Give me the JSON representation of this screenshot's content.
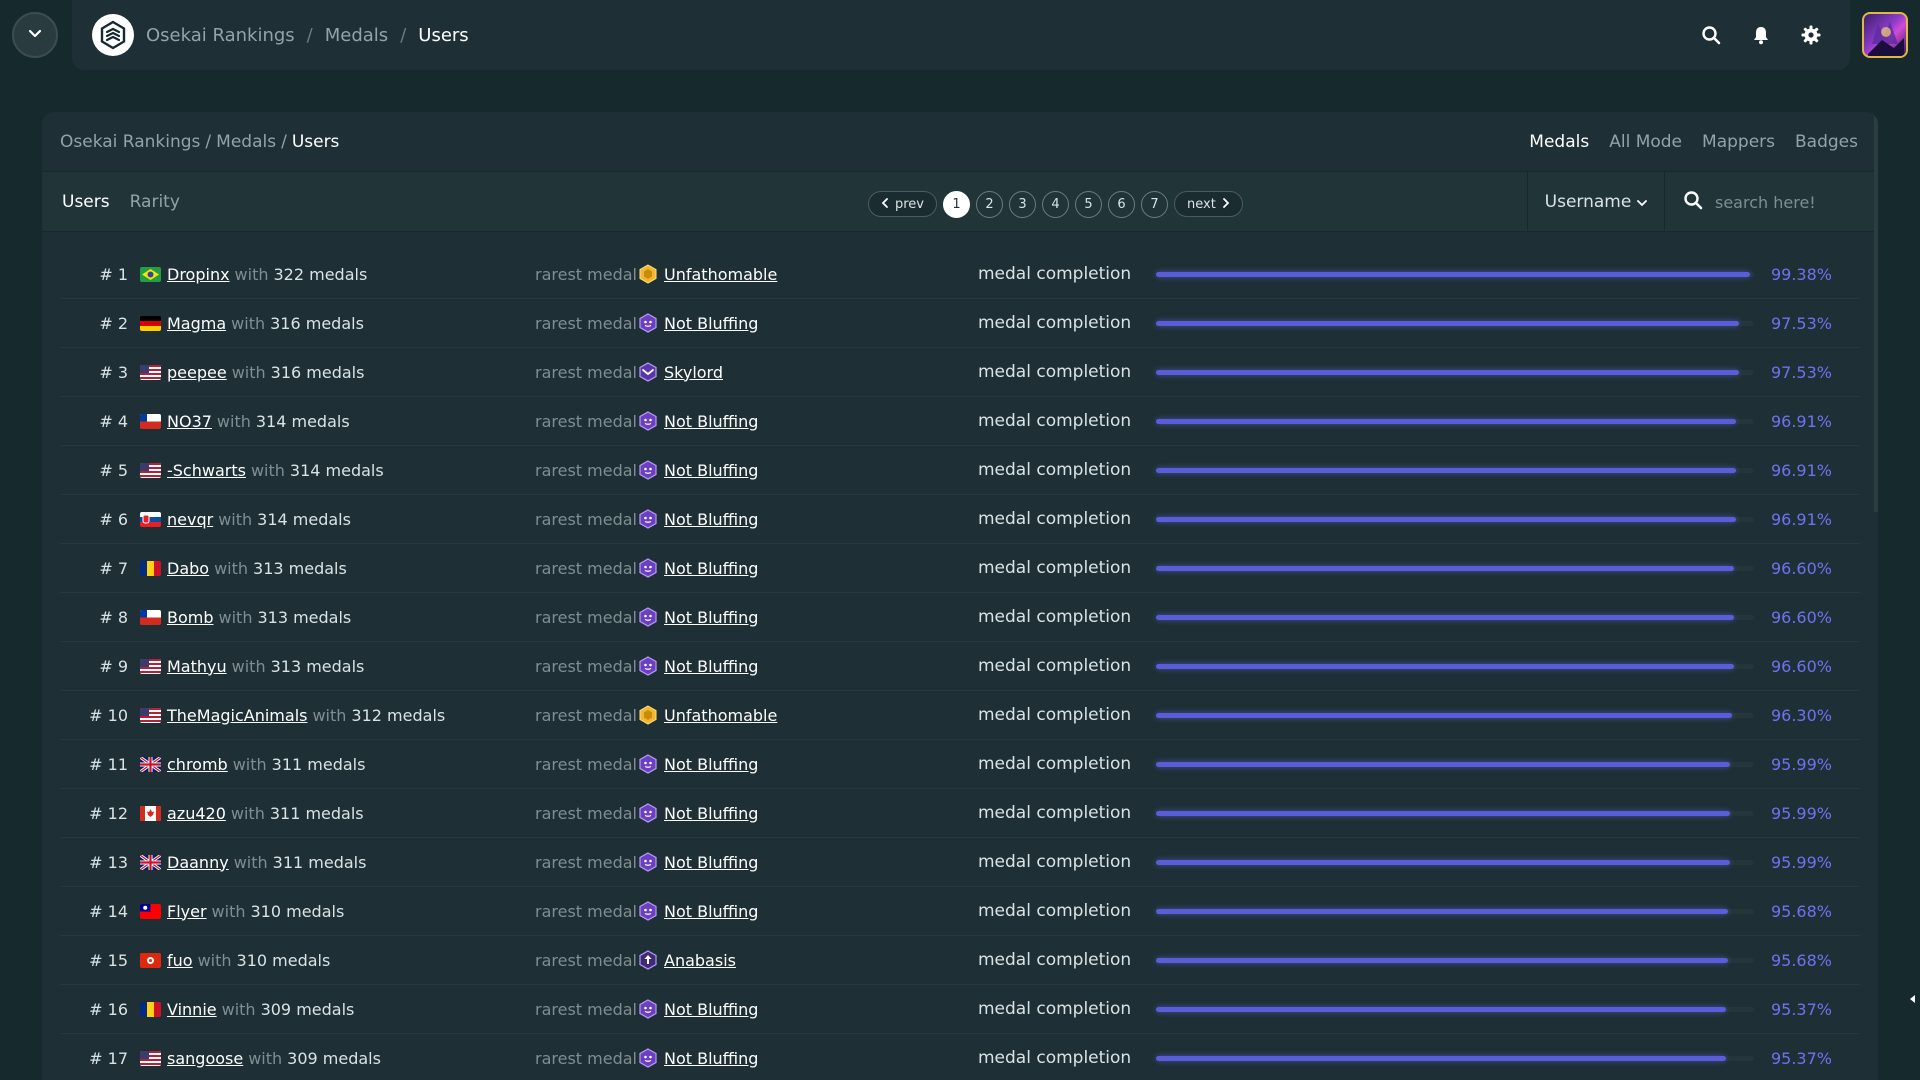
{
  "nav": {
    "breadcrumb": [
      "Osekai Rankings",
      "Medals",
      "Users"
    ]
  },
  "panel": {
    "breadcrumb": [
      "Osekai Rankings",
      "Medals",
      "Users"
    ],
    "mode_tabs": [
      "Medals",
      "All Mode",
      "Mappers",
      "Badges"
    ],
    "active_mode": "Medals"
  },
  "toolbar": {
    "view_tabs": [
      "Users",
      "Rarity"
    ],
    "active_view": "Users",
    "prev_label": "prev",
    "next_label": "next",
    "pages": [
      "1",
      "2",
      "3",
      "4",
      "5",
      "6",
      "7"
    ],
    "current_page": "1",
    "sort_label": "Username",
    "search_placeholder": "search here!"
  },
  "labels": {
    "with": "with",
    "rarest_medal": "rarest medal",
    "medal_completion": "medal completion"
  },
  "colors": {
    "background": "#16292d",
    "panel": "#1e3035",
    "accent": "#6f72f0",
    "bar": "#5a5dd8"
  },
  "rows": [
    {
      "rank": "# 1",
      "flag": "br",
      "username": "Dropinx",
      "medals": "322 medals",
      "rarest": "Unfathomable",
      "medal_icon": "gold-hexagon-medal-icon",
      "completion": "99.38%"
    },
    {
      "rank": "# 2",
      "flag": "de",
      "username": "Magma",
      "medals": "316 medals",
      "rarest": "Not Bluffing",
      "medal_icon": "purple-hexagon-medal-icon",
      "completion": "97.53%"
    },
    {
      "rank": "# 3",
      "flag": "us",
      "username": "peepee",
      "medals": "316 medals",
      "rarest": "Skylord",
      "medal_icon": "purple-shield-medal-icon",
      "completion": "97.53%"
    },
    {
      "rank": "# 4",
      "flag": "cl",
      "username": "NO37",
      "medals": "314 medals",
      "rarest": "Not Bluffing",
      "medal_icon": "purple-hexagon-medal-icon",
      "completion": "96.91%"
    },
    {
      "rank": "# 5",
      "flag": "us",
      "username": "-Schwarts",
      "medals": "314 medals",
      "rarest": "Not Bluffing",
      "medal_icon": "purple-hexagon-medal-icon",
      "completion": "96.91%"
    },
    {
      "rank": "# 6",
      "flag": "sk",
      "username": "nevqr",
      "medals": "314 medals",
      "rarest": "Not Bluffing",
      "medal_icon": "purple-hexagon-medal-icon",
      "completion": "96.91%"
    },
    {
      "rank": "# 7",
      "flag": "ro",
      "username": "Dabo",
      "medals": "313 medals",
      "rarest": "Not Bluffing",
      "medal_icon": "purple-hexagon-medal-icon",
      "completion": "96.60%"
    },
    {
      "rank": "# 8",
      "flag": "cl",
      "username": "Bomb",
      "medals": "313 medals",
      "rarest": "Not Bluffing",
      "medal_icon": "purple-hexagon-medal-icon",
      "completion": "96.60%"
    },
    {
      "rank": "# 9",
      "flag": "us",
      "username": "Mathyu",
      "medals": "313 medals",
      "rarest": "Not Bluffing",
      "medal_icon": "purple-hexagon-medal-icon",
      "completion": "96.60%"
    },
    {
      "rank": "# 10",
      "flag": "us",
      "username": "TheMagicAnimals",
      "medals": "312 medals",
      "rarest": "Unfathomable",
      "medal_icon": "gold-hexagon-medal-icon",
      "completion": "96.30%"
    },
    {
      "rank": "# 11",
      "flag": "gb",
      "username": "chromb",
      "medals": "311 medals",
      "rarest": "Not Bluffing",
      "medal_icon": "purple-hexagon-medal-icon",
      "completion": "95.99%"
    },
    {
      "rank": "# 12",
      "flag": "ca",
      "username": "azu420",
      "medals": "311 medals",
      "rarest": "Not Bluffing",
      "medal_icon": "purple-hexagon-medal-icon",
      "completion": "95.99%"
    },
    {
      "rank": "# 13",
      "flag": "gb",
      "username": "Daanny",
      "medals": "311 medals",
      "rarest": "Not Bluffing",
      "medal_icon": "purple-hexagon-medal-icon",
      "completion": "95.99%"
    },
    {
      "rank": "# 14",
      "flag": "tw",
      "username": "Flyer",
      "medals": "310 medals",
      "rarest": "Not Bluffing",
      "medal_icon": "purple-hexagon-medal-icon",
      "completion": "95.68%"
    },
    {
      "rank": "# 15",
      "flag": "hk",
      "username": "fuo",
      "medals": "310 medals",
      "rarest": "Anabasis",
      "medal_icon": "purple-arrow-medal-icon",
      "completion": "95.68%"
    },
    {
      "rank": "# 16",
      "flag": "ro",
      "username": "Vinnie",
      "medals": "309 medals",
      "rarest": "Not Bluffing",
      "medal_icon": "purple-hexagon-medal-icon",
      "completion": "95.37%"
    },
    {
      "rank": "# 17",
      "flag": "us",
      "username": "sangoose",
      "medals": "309 medals",
      "rarest": "Not Bluffing",
      "medal_icon": "purple-hexagon-medal-icon",
      "completion": "95.37%"
    }
  ]
}
